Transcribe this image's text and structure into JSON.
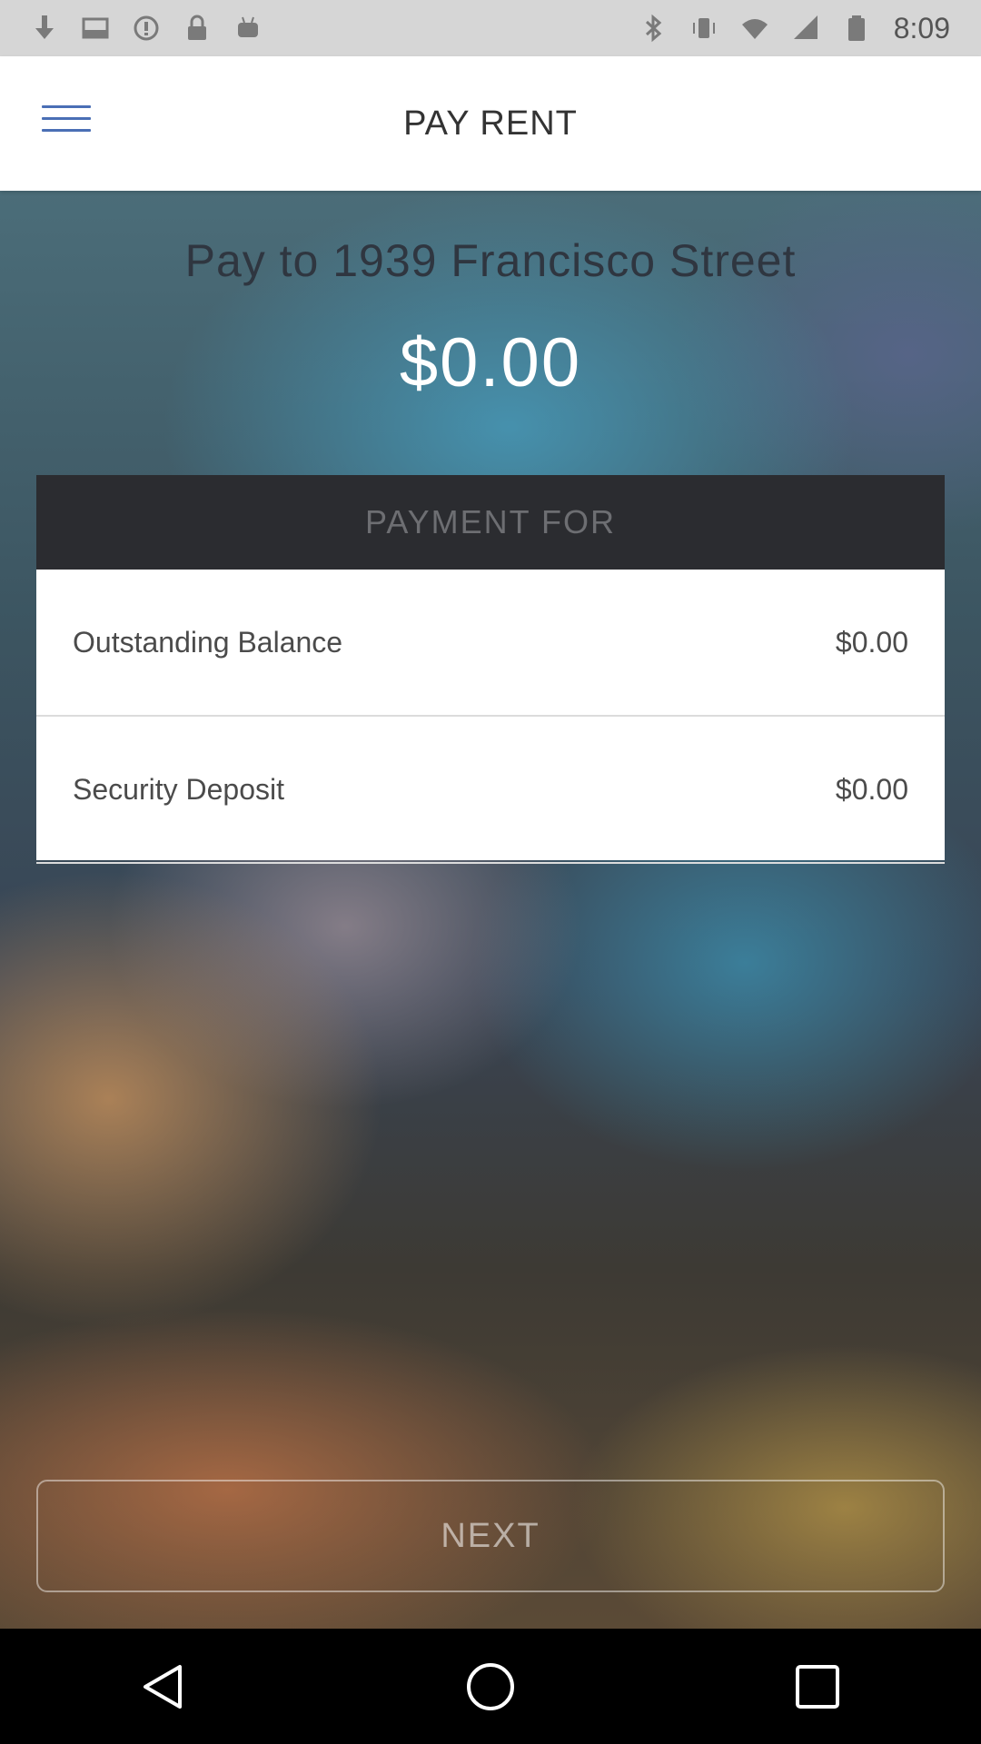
{
  "status_bar": {
    "time": "8:09",
    "left_icons": [
      "download-icon",
      "inbox-icon",
      "alert-icon",
      "lock-icon",
      "android-icon"
    ],
    "right_icons": [
      "bluetooth-icon",
      "vibrate-icon",
      "wifi-icon",
      "signal-icon",
      "battery-icon"
    ]
  },
  "header": {
    "title": "PAY RENT",
    "menu_icon": "hamburger-menu-icon"
  },
  "main": {
    "pay_to": "Pay to 1939 Francisco Street",
    "amount": "$0.00"
  },
  "payment_card": {
    "header": "PAYMENT FOR",
    "rows": [
      {
        "label": "Outstanding Balance",
        "value": "$0.00"
      },
      {
        "label": "Security Deposit",
        "value": "$0.00"
      }
    ]
  },
  "footer": {
    "next_label": "NEXT"
  },
  "nav_bar": {
    "icons": [
      "back-icon",
      "home-icon",
      "recents-icon"
    ]
  },
  "colors": {
    "accent": "#4a6fb5",
    "card_header_bg": "#2b2c30",
    "app_bar_bg": "#ffffff",
    "status_bar_bg": "#d6d6d6"
  }
}
